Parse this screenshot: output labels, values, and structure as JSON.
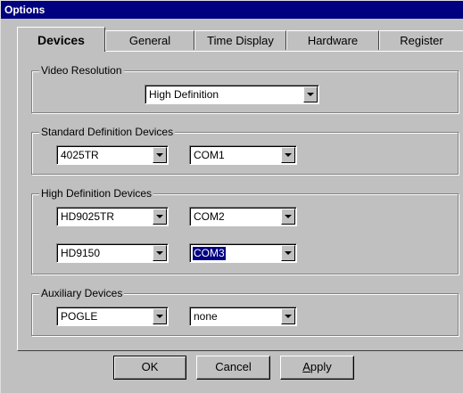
{
  "window": {
    "title": "Options"
  },
  "tabs": [
    {
      "label": "Devices"
    },
    {
      "label": "General"
    },
    {
      "label": "Time Display"
    },
    {
      "label": "Hardware"
    },
    {
      "label": "Register"
    }
  ],
  "video_resolution": {
    "label": "Video Resolution",
    "value": "High Definition"
  },
  "standard_definition": {
    "label": "Standard Definition Devices",
    "device": "4025TR",
    "port": "COM1"
  },
  "high_definition": {
    "label": "High Definition Devices",
    "rows": [
      {
        "device": "HD9025TR",
        "port": "COM2"
      },
      {
        "device": "HD9150",
        "port": "COM3"
      }
    ]
  },
  "auxiliary": {
    "label": "Auxiliary Devices",
    "device": "POGLE",
    "port": "none"
  },
  "buttons": {
    "ok": "OK",
    "cancel": "Cancel",
    "apply": "Apply"
  }
}
